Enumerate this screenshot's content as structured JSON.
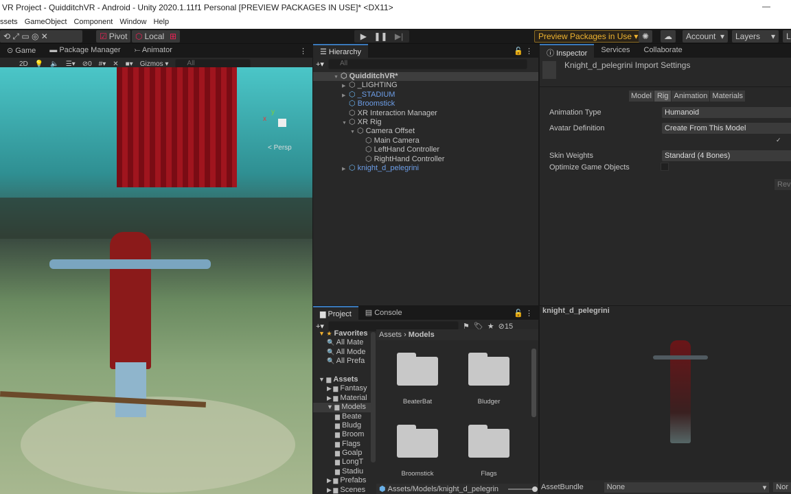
{
  "window": {
    "title": "VR Project - QuidditchVR - Android - Unity 2020.1.11f1 Personal [PREVIEW PACKAGES IN USE]* <DX11>"
  },
  "menu": [
    "ssets",
    "GameObject",
    "Component",
    "Window",
    "Help"
  ],
  "toolbar": {
    "pivot": "Pivot",
    "local": "Local",
    "preview_packages": "Preview Packages in Use ▾",
    "account": "Account",
    "layers": "Layers",
    "layout": "L"
  },
  "game_panel": {
    "tabs": [
      "Game",
      "Package Manager",
      "Animator"
    ],
    "mode_2d": "2D",
    "hidden_count": "0",
    "gizmos": "Gizmos",
    "search_placeholder": "All",
    "persp": "< Persp",
    "axis_y": "y",
    "axis_x": "x"
  },
  "hierarchy": {
    "tab": "Hierarchy",
    "search_placeholder": "All",
    "items": [
      {
        "label": "QuidditchVR*",
        "depth": 0,
        "blue": false,
        "arrow": "▼"
      },
      {
        "label": "_LIGHTING",
        "depth": 1,
        "blue": false,
        "arrow": "▶"
      },
      {
        "label": "_STADIUM",
        "depth": 1,
        "blue": true,
        "arrow": "▶"
      },
      {
        "label": "Broomstick",
        "depth": 1,
        "blue": true,
        "arrow": ""
      },
      {
        "label": "XR Interaction Manager",
        "depth": 1,
        "blue": false,
        "arrow": ""
      },
      {
        "label": "XR Rig",
        "depth": 1,
        "blue": false,
        "arrow": "▼"
      },
      {
        "label": "Camera Offset",
        "depth": 2,
        "blue": false,
        "arrow": "▼"
      },
      {
        "label": "Main Camera",
        "depth": 3,
        "blue": false,
        "arrow": ""
      },
      {
        "label": "LeftHand Controller",
        "depth": 3,
        "blue": false,
        "arrow": ""
      },
      {
        "label": "RightHand Controller",
        "depth": 3,
        "blue": false,
        "arrow": ""
      },
      {
        "label": "knight_d_pelegrini",
        "depth": 1,
        "blue": true,
        "arrow": "▶"
      }
    ]
  },
  "inspector": {
    "tabs": [
      "Inspector",
      "Services",
      "Collaborate"
    ],
    "title": "Knight_d_pelegrini Import Settings",
    "subtabs": [
      "Model",
      "Rig",
      "Animation",
      "Materials"
    ],
    "fields": {
      "animation_type_label": "Animation Type",
      "animation_type": "Humanoid",
      "avatar_def_label": "Avatar Definition",
      "avatar_def": "Create From This Model",
      "skin_weights_label": "Skin Weights",
      "skin_weights": "Standard (4 Bones)",
      "optimize_label": "Optimize Game Objects",
      "revert": "Rev"
    }
  },
  "preview": {
    "title": "knight_d_pelegrini",
    "assetbundle_label": "AssetBundle",
    "assetbundle_value": "None",
    "variant_value": "Nor"
  },
  "project": {
    "tabs": [
      "Project",
      "Console"
    ],
    "hidden_count": "15",
    "tree": [
      {
        "label": "Favorites",
        "depth": 0,
        "kind": "fav"
      },
      {
        "label": "All Mate",
        "depth": 1,
        "kind": "search"
      },
      {
        "label": "All Mode",
        "depth": 1,
        "kind": "search"
      },
      {
        "label": "All Prefa",
        "depth": 1,
        "kind": "search"
      },
      {
        "label": "",
        "depth": 0,
        "kind": "gap"
      },
      {
        "label": "Assets",
        "depth": 0,
        "kind": "root"
      },
      {
        "label": "Fantasy",
        "depth": 1,
        "kind": "folder"
      },
      {
        "label": "Material",
        "depth": 1,
        "kind": "folder"
      },
      {
        "label": "Models",
        "depth": 1,
        "kind": "open"
      },
      {
        "label": "Beate",
        "depth": 2,
        "kind": "folder"
      },
      {
        "label": "Bludg",
        "depth": 2,
        "kind": "folder"
      },
      {
        "label": "Broom",
        "depth": 2,
        "kind": "folder"
      },
      {
        "label": "Flags",
        "depth": 2,
        "kind": "folder"
      },
      {
        "label": "Goalp",
        "depth": 2,
        "kind": "folder"
      },
      {
        "label": "LongT",
        "depth": 2,
        "kind": "folder"
      },
      {
        "label": "Stadiu",
        "depth": 2,
        "kind": "folder"
      },
      {
        "label": "Prefabs",
        "depth": 1,
        "kind": "folder"
      },
      {
        "label": "Scenes",
        "depth": 1,
        "kind": "folder"
      }
    ],
    "breadcrumb": [
      "Assets",
      "Models"
    ],
    "folders": [
      "BeaterBat",
      "Bludger",
      "Broomstick",
      "Flags"
    ],
    "path": "Assets/Models/knight_d_pelegrin"
  }
}
